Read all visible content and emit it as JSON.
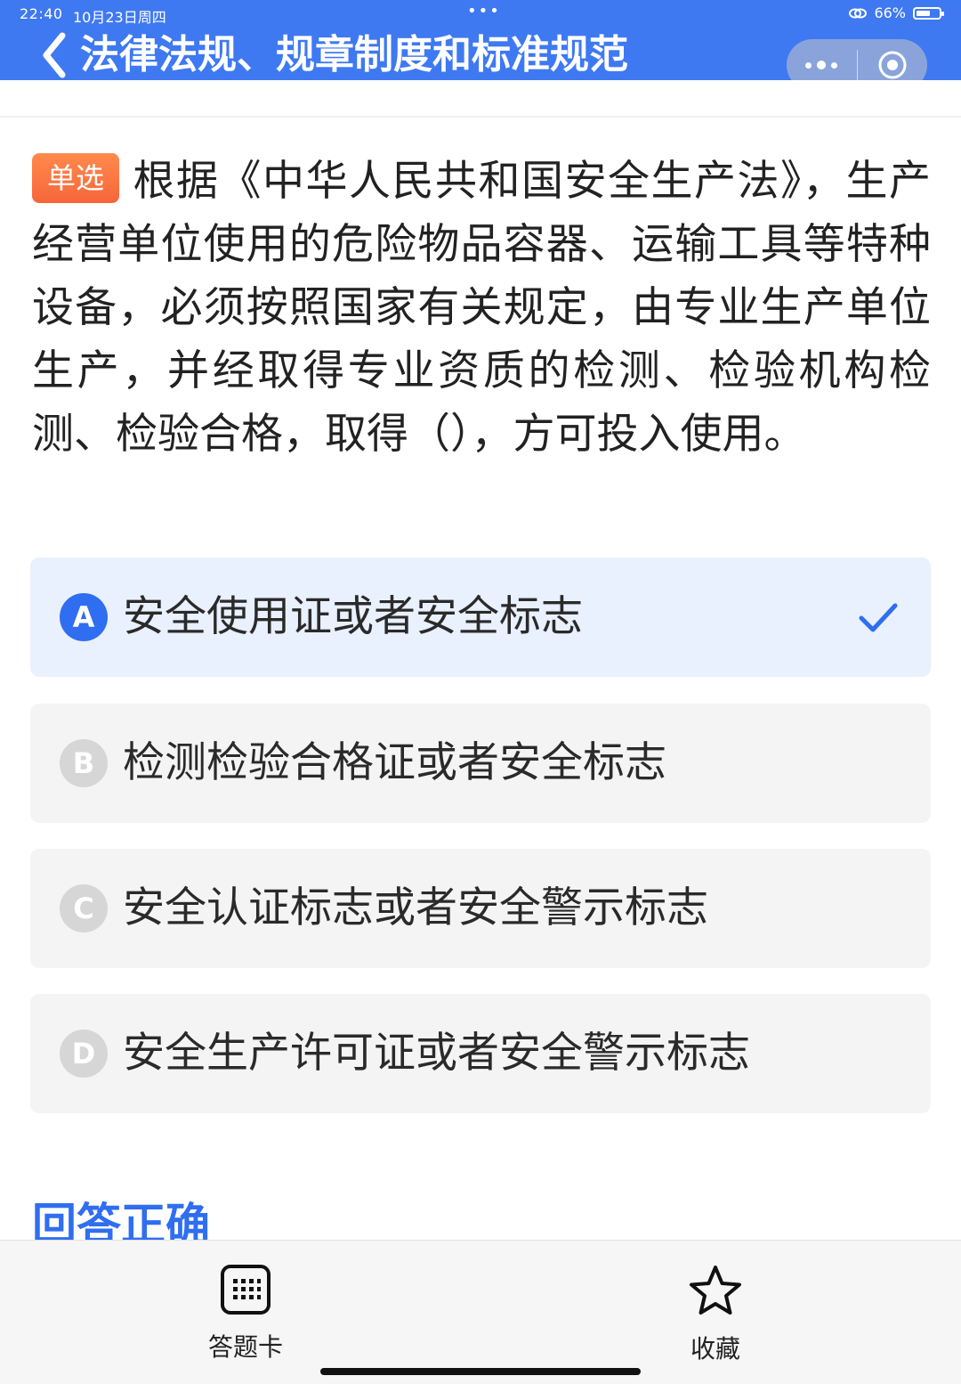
{
  "status_bar": {
    "time": "22:40",
    "date": "10月23日周四",
    "dots": "•••",
    "battery": "66%"
  },
  "header": {
    "title": "法律法规、规章制度和标准规范"
  },
  "question": {
    "type_badge": "单选",
    "text": "根据《中华人民共和国安全生产法》，生产经营单位使用的危险物品容器、运输工具等特种设备，必须按照国家有关规定，由专业生产单位生产，并经取得专业资质的检测、检验机构检测、检验合格，取得（），方可投入使用。"
  },
  "options": [
    {
      "letter": "A",
      "text": "安全使用证或者安全标志",
      "selected": true
    },
    {
      "letter": "B",
      "text": "检测检验合格证或者安全标志",
      "selected": false
    },
    {
      "letter": "C",
      "text": "安全认证标志或者安全警示标志",
      "selected": false
    },
    {
      "letter": "D",
      "text": "安全生产许可证或者安全警示标志",
      "selected": false
    }
  ],
  "result_text": "回答正确",
  "bottom_bar": {
    "answer_card_label": "答题卡",
    "favorite_label": "收藏"
  },
  "colors": {
    "header_bg": "#3f79f2",
    "accent": "#2f6ef0",
    "badge": "#f7663a",
    "selected_bg": "#e9f0fe"
  }
}
